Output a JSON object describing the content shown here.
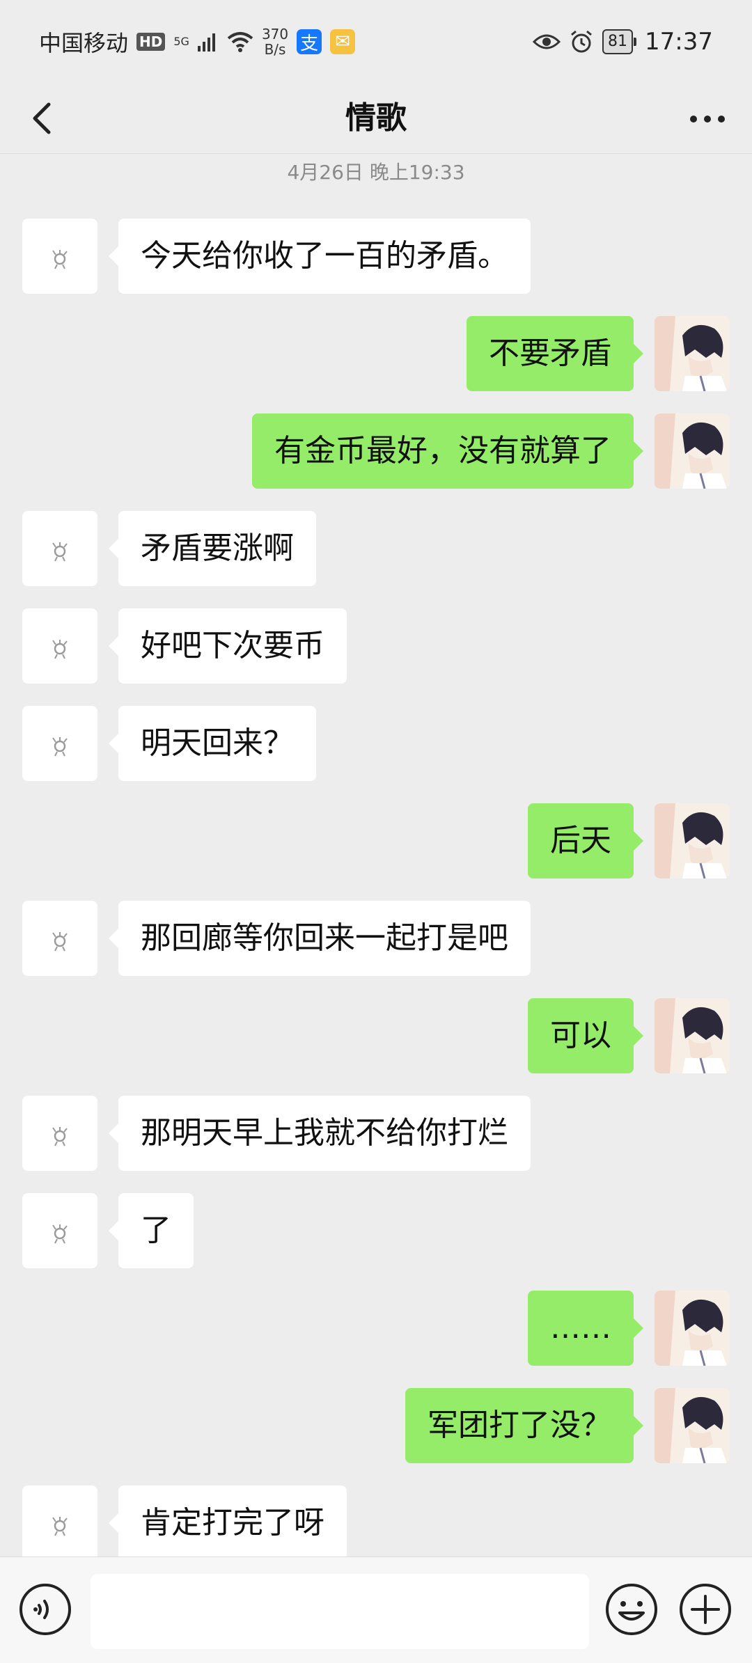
{
  "status_bar": {
    "carrier": "中国移动",
    "hd": "HD",
    "network": "5G",
    "speed_value": "370",
    "speed_unit": "B/s",
    "battery": "81",
    "time": "17:37"
  },
  "header": {
    "title": "情歌"
  },
  "timestamp": "4月26日 晚上19:33",
  "messages": [
    {
      "side": "left",
      "text": "今天给你收了一百的矛盾。"
    },
    {
      "side": "right",
      "text": "不要矛盾"
    },
    {
      "side": "right",
      "text": "有金币最好，没有就算了"
    },
    {
      "side": "left",
      "text": "矛盾要涨啊"
    },
    {
      "side": "left",
      "text": "好吧下次要币"
    },
    {
      "side": "left",
      "text": "明天回来？"
    },
    {
      "side": "right",
      "text": "后天"
    },
    {
      "side": "left",
      "text": "那回廊等你回来一起打是吧"
    },
    {
      "side": "right",
      "text": "可以"
    },
    {
      "side": "left",
      "text": "那明天早上我就不给你打烂"
    },
    {
      "side": "left",
      "text": "了"
    },
    {
      "side": "right",
      "text": "……"
    },
    {
      "side": "right",
      "text": "军团打了没？"
    },
    {
      "side": "left",
      "text": "肯定打完了呀"
    }
  ],
  "colors": {
    "sent_bubble": "#95ec69",
    "received_bubble": "#ffffff",
    "background": "#ededed"
  }
}
